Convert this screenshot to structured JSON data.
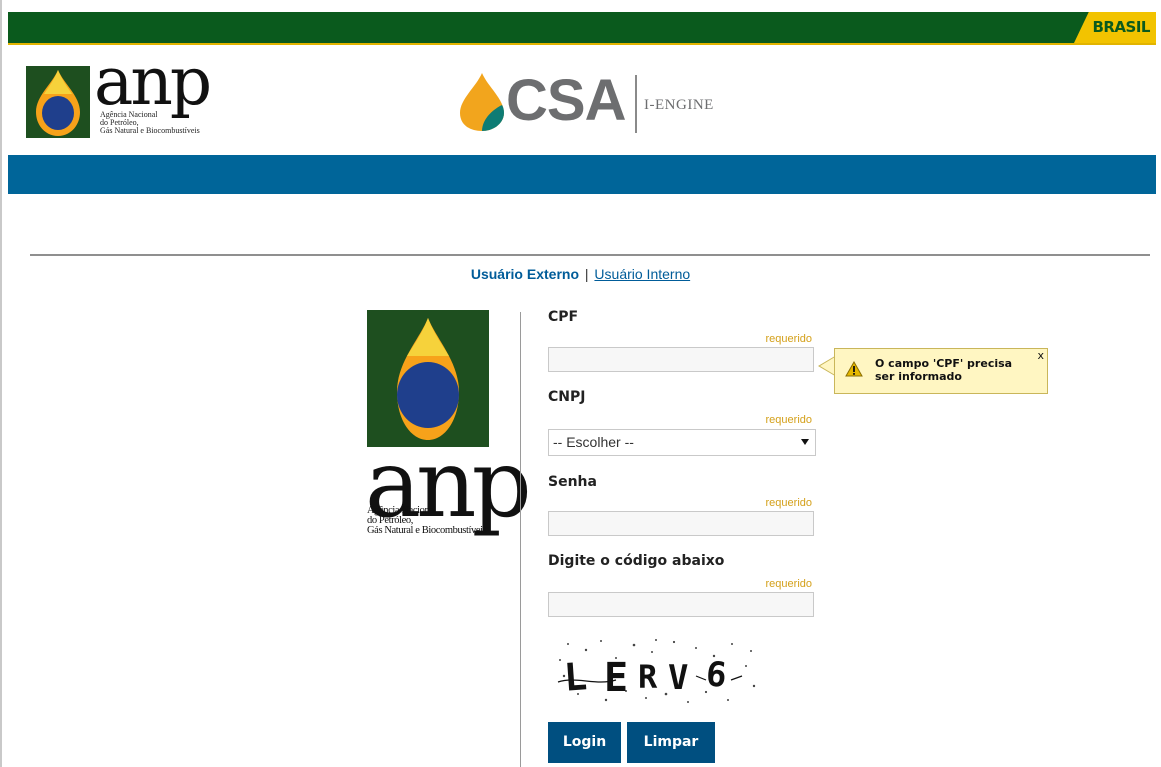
{
  "gov_bar": {
    "brasil_label": "BRASIL"
  },
  "header": {
    "anp_logo": {
      "word": "anp",
      "subtitle": "Agência Nacional\ndo Petróleo,\nGás Natural e Biocombustíveis"
    },
    "csa_logo": {
      "word": "CSA",
      "engine": "I-ENGINE"
    }
  },
  "user_tabs": {
    "external": "Usuário Externo",
    "separator": "|",
    "internal": "Usuário Interno"
  },
  "side_logo": {
    "word": "anp",
    "subtitle": "Agência Nacional\ndo Petróleo,\nGás Natural e Biocombustíveis"
  },
  "form": {
    "cpf": {
      "label": "CPF",
      "required": "requerido",
      "value": ""
    },
    "cnpj": {
      "label": "CNPJ",
      "required": "requerido",
      "selected": "-- Escolher --"
    },
    "senha": {
      "label": "Senha",
      "required": "requerido",
      "value": ""
    },
    "captcha": {
      "label": "Digite o código abaixo",
      "required": "requerido",
      "value": "",
      "image_text": "LERV6"
    },
    "login_button": "Login",
    "clear_button": "Limpar"
  },
  "tooltip": {
    "message": "O campo 'CPF' precisa ser informado",
    "close": "x"
  },
  "colors": {
    "gov_green": "#0a5a1d",
    "gov_yellow": "#f2c300",
    "blue_bar": "#006599",
    "button_blue": "#004f80",
    "link_blue": "#005c99",
    "required_gold": "#d4a01a"
  }
}
